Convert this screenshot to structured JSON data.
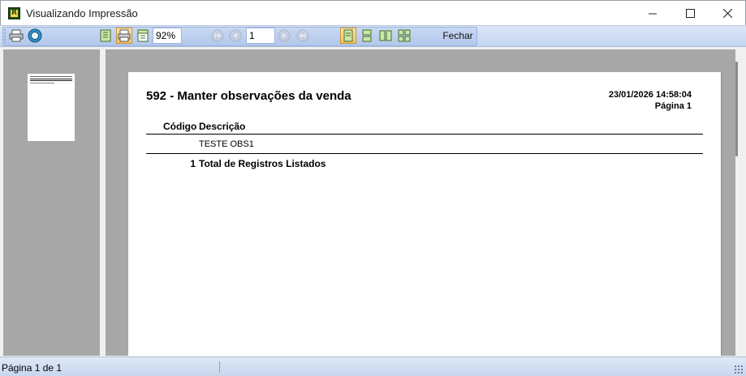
{
  "window": {
    "title": "Visualizando Impressão",
    "app_icon_letter": "R",
    "minimize_icon": "minimize-icon",
    "maximize_icon": "maximize-icon",
    "close_icon": "close-icon"
  },
  "toolbar": {
    "zoom_value": "92%",
    "page_value": "1",
    "close_label": "Fechar",
    "icons": [
      "printer-icon",
      "globe-icon",
      "page-view-icon",
      "print-preview-icon",
      "page-width-icon",
      "first-page-icon",
      "prev-page-icon",
      "next-page-icon",
      "last-page-icon",
      "single-page-icon",
      "two-page-vertical-icon",
      "two-page-horizontal-icon",
      "four-page-icon"
    ]
  },
  "report": {
    "title": "592 - Manter observações da venda",
    "date": "23/01/2026 14:58:04",
    "page": "Página 1",
    "columns": {
      "codigo": "Código",
      "descricao": "Descrição"
    },
    "rows": [
      {
        "codigo": "",
        "descricao": "TESTE OBS1"
      }
    ],
    "total_count": "1",
    "total_label": "Total de Registros Listados"
  },
  "status": {
    "text": "Página 1 de 1"
  },
  "colors": {
    "toolbar": "#c4d5ef",
    "preview_bg": "#a7a7a7",
    "active_button": "#f8c25c"
  }
}
